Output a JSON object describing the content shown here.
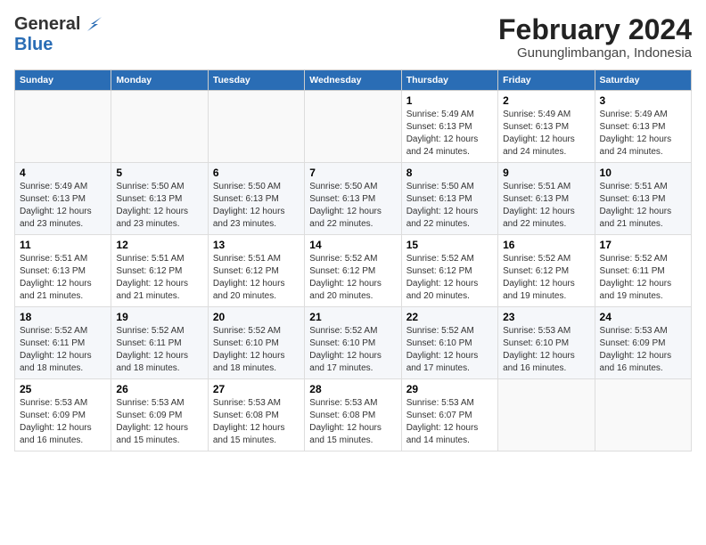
{
  "header": {
    "logo_general": "General",
    "logo_blue": "Blue",
    "title": "February 2024",
    "subtitle": "Gununglimbangan, Indonesia"
  },
  "days_of_week": [
    "Sunday",
    "Monday",
    "Tuesday",
    "Wednesday",
    "Thursday",
    "Friday",
    "Saturday"
  ],
  "weeks": [
    [
      {
        "day": "",
        "info": ""
      },
      {
        "day": "",
        "info": ""
      },
      {
        "day": "",
        "info": ""
      },
      {
        "day": "",
        "info": ""
      },
      {
        "day": "1",
        "info": "Sunrise: 5:49 AM\nSunset: 6:13 PM\nDaylight: 12 hours\nand 24 minutes."
      },
      {
        "day": "2",
        "info": "Sunrise: 5:49 AM\nSunset: 6:13 PM\nDaylight: 12 hours\nand 24 minutes."
      },
      {
        "day": "3",
        "info": "Sunrise: 5:49 AM\nSunset: 6:13 PM\nDaylight: 12 hours\nand 24 minutes."
      }
    ],
    [
      {
        "day": "4",
        "info": "Sunrise: 5:49 AM\nSunset: 6:13 PM\nDaylight: 12 hours\nand 23 minutes."
      },
      {
        "day": "5",
        "info": "Sunrise: 5:50 AM\nSunset: 6:13 PM\nDaylight: 12 hours\nand 23 minutes."
      },
      {
        "day": "6",
        "info": "Sunrise: 5:50 AM\nSunset: 6:13 PM\nDaylight: 12 hours\nand 23 minutes."
      },
      {
        "day": "7",
        "info": "Sunrise: 5:50 AM\nSunset: 6:13 PM\nDaylight: 12 hours\nand 22 minutes."
      },
      {
        "day": "8",
        "info": "Sunrise: 5:50 AM\nSunset: 6:13 PM\nDaylight: 12 hours\nand 22 minutes."
      },
      {
        "day": "9",
        "info": "Sunrise: 5:51 AM\nSunset: 6:13 PM\nDaylight: 12 hours\nand 22 minutes."
      },
      {
        "day": "10",
        "info": "Sunrise: 5:51 AM\nSunset: 6:13 PM\nDaylight: 12 hours\nand 21 minutes."
      }
    ],
    [
      {
        "day": "11",
        "info": "Sunrise: 5:51 AM\nSunset: 6:13 PM\nDaylight: 12 hours\nand 21 minutes."
      },
      {
        "day": "12",
        "info": "Sunrise: 5:51 AM\nSunset: 6:12 PM\nDaylight: 12 hours\nand 21 minutes."
      },
      {
        "day": "13",
        "info": "Sunrise: 5:51 AM\nSunset: 6:12 PM\nDaylight: 12 hours\nand 20 minutes."
      },
      {
        "day": "14",
        "info": "Sunrise: 5:52 AM\nSunset: 6:12 PM\nDaylight: 12 hours\nand 20 minutes."
      },
      {
        "day": "15",
        "info": "Sunrise: 5:52 AM\nSunset: 6:12 PM\nDaylight: 12 hours\nand 20 minutes."
      },
      {
        "day": "16",
        "info": "Sunrise: 5:52 AM\nSunset: 6:12 PM\nDaylight: 12 hours\nand 19 minutes."
      },
      {
        "day": "17",
        "info": "Sunrise: 5:52 AM\nSunset: 6:11 PM\nDaylight: 12 hours\nand 19 minutes."
      }
    ],
    [
      {
        "day": "18",
        "info": "Sunrise: 5:52 AM\nSunset: 6:11 PM\nDaylight: 12 hours\nand 18 minutes."
      },
      {
        "day": "19",
        "info": "Sunrise: 5:52 AM\nSunset: 6:11 PM\nDaylight: 12 hours\nand 18 minutes."
      },
      {
        "day": "20",
        "info": "Sunrise: 5:52 AM\nSunset: 6:10 PM\nDaylight: 12 hours\nand 18 minutes."
      },
      {
        "day": "21",
        "info": "Sunrise: 5:52 AM\nSunset: 6:10 PM\nDaylight: 12 hours\nand 17 minutes."
      },
      {
        "day": "22",
        "info": "Sunrise: 5:52 AM\nSunset: 6:10 PM\nDaylight: 12 hours\nand 17 minutes."
      },
      {
        "day": "23",
        "info": "Sunrise: 5:53 AM\nSunset: 6:10 PM\nDaylight: 12 hours\nand 16 minutes."
      },
      {
        "day": "24",
        "info": "Sunrise: 5:53 AM\nSunset: 6:09 PM\nDaylight: 12 hours\nand 16 minutes."
      }
    ],
    [
      {
        "day": "25",
        "info": "Sunrise: 5:53 AM\nSunset: 6:09 PM\nDaylight: 12 hours\nand 16 minutes."
      },
      {
        "day": "26",
        "info": "Sunrise: 5:53 AM\nSunset: 6:09 PM\nDaylight: 12 hours\nand 15 minutes."
      },
      {
        "day": "27",
        "info": "Sunrise: 5:53 AM\nSunset: 6:08 PM\nDaylight: 12 hours\nand 15 minutes."
      },
      {
        "day": "28",
        "info": "Sunrise: 5:53 AM\nSunset: 6:08 PM\nDaylight: 12 hours\nand 15 minutes."
      },
      {
        "day": "29",
        "info": "Sunrise: 5:53 AM\nSunset: 6:07 PM\nDaylight: 12 hours\nand 14 minutes."
      },
      {
        "day": "",
        "info": ""
      },
      {
        "day": "",
        "info": ""
      }
    ]
  ]
}
